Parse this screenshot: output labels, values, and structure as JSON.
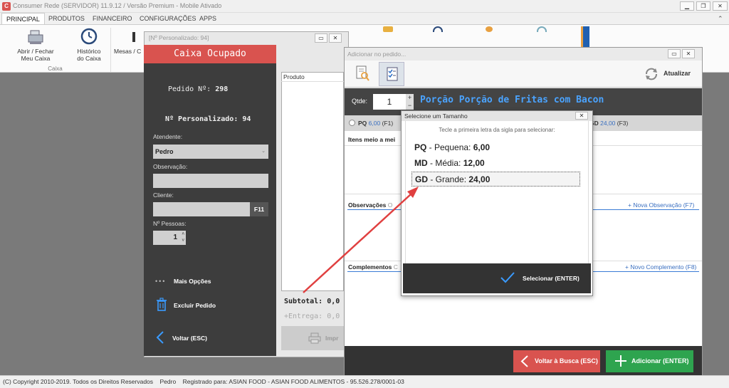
{
  "app": {
    "title": "Consumer Rede (SERVIDOR) 11.9.12 / Versão Premium - Mobile Ativado",
    "logo": "C"
  },
  "ribbon": {
    "tabs": [
      "PRINCIPAL",
      "PRODUTOS",
      "FINANCEIRO",
      "CONFIGURAÇÕES",
      "APPS"
    ],
    "active_tab": "PRINCIPAL",
    "buttons": {
      "abrir_fechar_1": "Abrir / Fechar",
      "abrir_fechar_2": "Meu Caixa",
      "historico_1": "Histórico",
      "historico_2": "do Caixa",
      "mesas": "Mesas / C"
    },
    "group_caixa": "Caixa"
  },
  "perso_window": {
    "title": "[Nº Personalizado: 94]",
    "banner": "Caixa Ocupado",
    "pedido_label": "Pedido Nº:",
    "pedido_value": "298",
    "num_perso_label": "Nº Personalizado:",
    "num_perso_value": "94",
    "atendente_label": "Atendente:",
    "atendente_value": "Pedro",
    "observacao_label": "Observação:",
    "cliente_label": "Cliente:",
    "cliente_key": "F11",
    "pessoas_label": "Nº Pessoas:",
    "pessoas_value": "1",
    "mais_opcoes": "Mais Opções",
    "excluir": "Excluir Pedido",
    "voltar": "Voltar (ESC)",
    "produto_header": "Produto",
    "subtotal": "Subtotal: 0,0",
    "entrega": "+Entrega: 0,0",
    "imprimir": "Impr"
  },
  "add_window": {
    "title": "Adicionar no pedido...",
    "atualizar": "Atualizar",
    "qtde_label": "Qtde:",
    "qtde_value": "1",
    "product_name": "Porção Porção de Fritas com Bacon",
    "size_pq": "PQ",
    "size_pq_price": "6,00",
    "size_pq_key": "(F1)",
    "size_gd": "GD",
    "size_gd_price": "24,00",
    "size_gd_key": "(F3)",
    "itens_meio": "Itens meio a mei",
    "observacoes": "Observações",
    "observacoes_hint": "O",
    "nova_obs": "+ Nova Observação (F7)",
    "complementos": "Complementos",
    "complementos_hint": "C",
    "novo_comp": "+ Novo Complemento (F8)",
    "voltar_busca": "Voltar à Busca (ESC)",
    "adicionar": "Adicionar (ENTER)"
  },
  "dialog": {
    "title": "Selecione um Tamanho",
    "hint": "Tecle a primeira letra da sigla para selecionar:",
    "options": [
      {
        "code": "PQ",
        "name": " - Pequena: ",
        "price": "6,00"
      },
      {
        "code": "MD",
        "name": " - Média: ",
        "price": "12,00"
      },
      {
        "code": "GD",
        "name": " - Grande: ",
        "price": "24,00"
      }
    ],
    "selected_index": 2,
    "select_button": "Selecionar (ENTER)"
  },
  "statusbar": {
    "copyright": "(C) Copyright 2010-2019. Todos os Direitos Reservados",
    "user": "Pedro",
    "registrado": "Registrado para: ASIAN FOOD - ASIAN FOOD ALIMENTOS - 95.526.278/0001-03"
  },
  "colors": {
    "accent_red": "#d9534f",
    "accent_green": "#2ea44f",
    "link_blue": "#3a6fc0",
    "product_blue": "#4aa3ff",
    "annotation_arrow": "#e04040"
  }
}
